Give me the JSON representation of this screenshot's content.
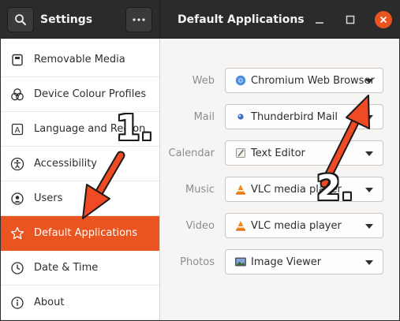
{
  "header": {
    "left_title": "Settings",
    "main_title": "Default Applications"
  },
  "sidebar": {
    "items": [
      {
        "label": "Removable Media",
        "icon": "removable-media-icon"
      },
      {
        "label": "Device Colour Profiles",
        "icon": "colour-profiles-icon"
      },
      {
        "label": "Language and Region",
        "icon": "language-icon"
      },
      {
        "label": "Accessibility",
        "icon": "accessibility-icon"
      },
      {
        "label": "Users",
        "icon": "users-icon"
      },
      {
        "label": "Default Applications",
        "icon": "default-apps-icon",
        "active": true
      },
      {
        "label": "Date & Time",
        "icon": "clock-icon"
      },
      {
        "label": "About",
        "icon": "info-icon"
      }
    ]
  },
  "defaults": [
    {
      "label": "Web",
      "app": "Chromium Web Browser",
      "icon": "chromium-icon"
    },
    {
      "label": "Mail",
      "app": "Thunderbird Mail",
      "icon": "thunderbird-icon"
    },
    {
      "label": "Calendar",
      "app": "Text Editor",
      "icon": "text-editor-icon"
    },
    {
      "label": "Music",
      "app": "VLC media player",
      "icon": "vlc-icon"
    },
    {
      "label": "Video",
      "app": "VLC media player",
      "icon": "vlc-icon"
    },
    {
      "label": "Photos",
      "app": "Image Viewer",
      "icon": "image-viewer-icon"
    }
  ],
  "annotations": {
    "step1": "1.",
    "step2": "2."
  },
  "colors": {
    "accent": "#e95420",
    "header_bg": "#2b2b2b",
    "sidebar_bg": "#ffffff",
    "content_bg": "#f6f5f4",
    "arrow": "#ef4a24"
  }
}
